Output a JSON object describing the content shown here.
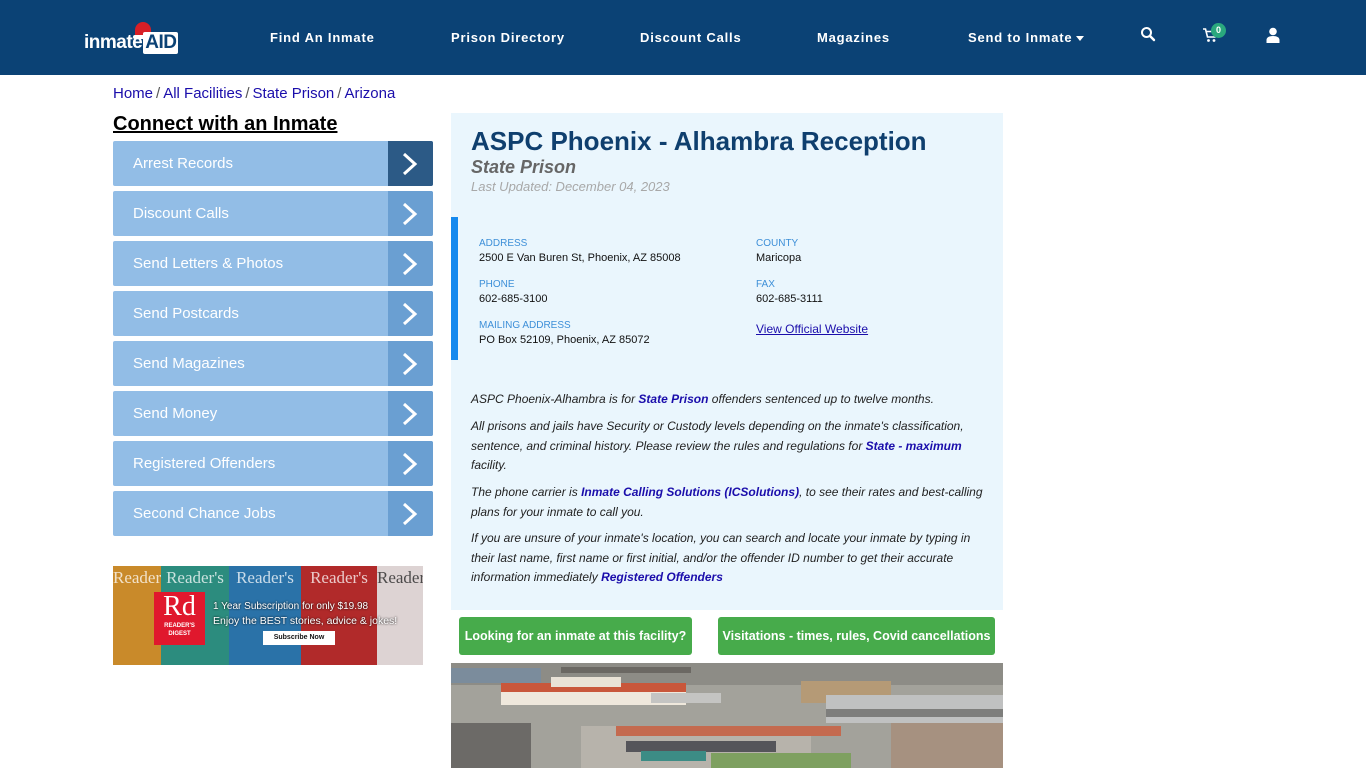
{
  "header": {
    "logo": {
      "text_main": "inmate",
      "text_accent": "AID"
    },
    "nav": [
      {
        "label": "Find An Inmate"
      },
      {
        "label": "Prison Directory"
      },
      {
        "label": "Discount Calls"
      },
      {
        "label": "Magazines"
      },
      {
        "label": "Send to Inmate",
        "has_dropdown": true
      }
    ],
    "icons": {
      "search": "search-icon",
      "cart": "cart-icon",
      "user": "user-icon"
    },
    "cart_count": "0"
  },
  "breadcrumb": [
    {
      "label": "Home"
    },
    {
      "label": "All Facilities"
    },
    {
      "label": "State Prison"
    },
    {
      "label": "Arizona"
    }
  ],
  "sidebar": {
    "title": "Connect with an Inmate",
    "items": [
      {
        "label": "Arrest Records",
        "active": true
      },
      {
        "label": "Discount Calls"
      },
      {
        "label": "Send Letters & Photos"
      },
      {
        "label": "Send Postcards"
      },
      {
        "label": "Send Magazines"
      },
      {
        "label": "Send Money"
      },
      {
        "label": "Registered Offenders"
      },
      {
        "label": "Second Chance Jobs"
      }
    ],
    "ad": {
      "cover_title": "Reader's",
      "brand_short": "Rd",
      "brand_name": "READER'S DIGEST",
      "line1": "1 Year Subscription for only $19.98",
      "line2": "Enjoy the BEST stories, advice & jokes!",
      "button": "Subscribe Now"
    }
  },
  "facility": {
    "name": "ASPC Phoenix - Alhambra Reception",
    "type": "State Prison",
    "last_updated": "Last Updated: December 04, 2023",
    "info": {
      "address_label": "ADDRESS",
      "address": "2500 E Van Buren St, Phoenix, AZ 85008",
      "county_label": "COUNTY",
      "county": "Maricopa",
      "phone_label": "PHONE",
      "phone": "602-685-3100",
      "fax_label": "FAX",
      "fax": "602-685-3111",
      "mailing_label": "MAILING ADDRESS",
      "mailing": "PO Box 52109, Phoenix, AZ 85072",
      "website_link": "View Official Website"
    },
    "description": {
      "p1_a": "ASPC Phoenix-Alhambra is for ",
      "p1_link": "State Prison",
      "p1_b": " offenders sentenced up to twelve months.",
      "p2_a": "All prisons and jails have Security or Custody levels depending on the inmate's classification, sentence, and criminal history. Please review the rules and regulations for ",
      "p2_link": "State - maximum",
      "p2_b": " facility.",
      "p3_a": "The phone carrier is ",
      "p3_link": "Inmate Calling Solutions (ICSolutions)",
      "p3_b": ", to see their rates and best-calling plans for your inmate to call you.",
      "p4_a": "If you are unsure of your inmate's location, you can search and locate your inmate by typing in their last name, first name or first initial, and/or the offender ID number to get their accurate information immediately ",
      "p4_link": "Registered Offenders"
    },
    "buttons": {
      "find_inmate": "Looking for an inmate at this facility?",
      "visitations": "Visitations - times, rules, Covid cancellations"
    }
  },
  "colors": {
    "nav_bg": "#0b4275",
    "sidebar_item": "#92bde6",
    "sidebar_arrow": "#6a9fd2",
    "sidebar_arrow_active": "#2c5a86",
    "card_bg": "#eaf6fd",
    "accent_blue": "#1589ee",
    "green_button": "#47ab4b",
    "title": "#0f3f6e"
  }
}
